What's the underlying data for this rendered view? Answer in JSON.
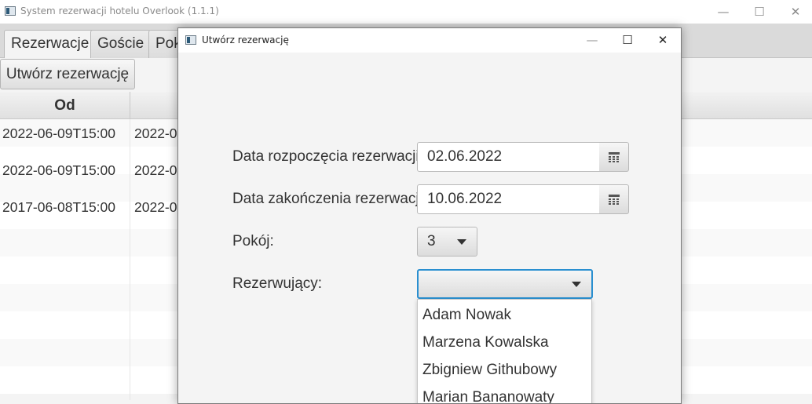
{
  "window": {
    "title": "System rezerwacji hotelu Overlook (1.1.1)",
    "minimize_glyph": "—",
    "maximize_glyph": "☐",
    "close_glyph": "✕"
  },
  "tabs": [
    {
      "label": "Rezerwacje",
      "selected": true
    },
    {
      "label": "Goście",
      "selected": false
    },
    {
      "label": "Pok",
      "selected": false
    }
  ],
  "toolbar": {
    "create_label": "Utwórz rezerwację"
  },
  "table": {
    "headers": [
      "Od",
      ""
    ],
    "rows": [
      [
        "2022-06-09T15:00",
        "2022-0"
      ],
      [
        "2022-06-09T15:00",
        "2022-0"
      ],
      [
        "2017-06-08T15:00",
        "2022-0"
      ]
    ]
  },
  "dialog": {
    "title": "Utwórz rezerwację",
    "minimize_glyph": "—",
    "maximize_glyph": "☐",
    "close_glyph": "✕",
    "start_label": "Data rozpoczęcia rezerwacji:",
    "start_value": "02.06.2022",
    "end_label": "Data zakończenia rezerwacji:",
    "end_value": "10.06.2022",
    "room_label": "Pokój:",
    "room_value": "3",
    "guest_label": "Rezerwujący:",
    "guest_value": "",
    "guest_options": [
      "Adam Nowak",
      "Marzena Kowalska",
      "Zbigniew Githubowy",
      "Marian Bananowaty"
    ]
  },
  "colors": {
    "focus": "#2a8fd0",
    "tab_bar": "#dadada"
  },
  "icons": [
    "app-icon",
    "calendar-icon",
    "dropdown-arrow-icon"
  ]
}
